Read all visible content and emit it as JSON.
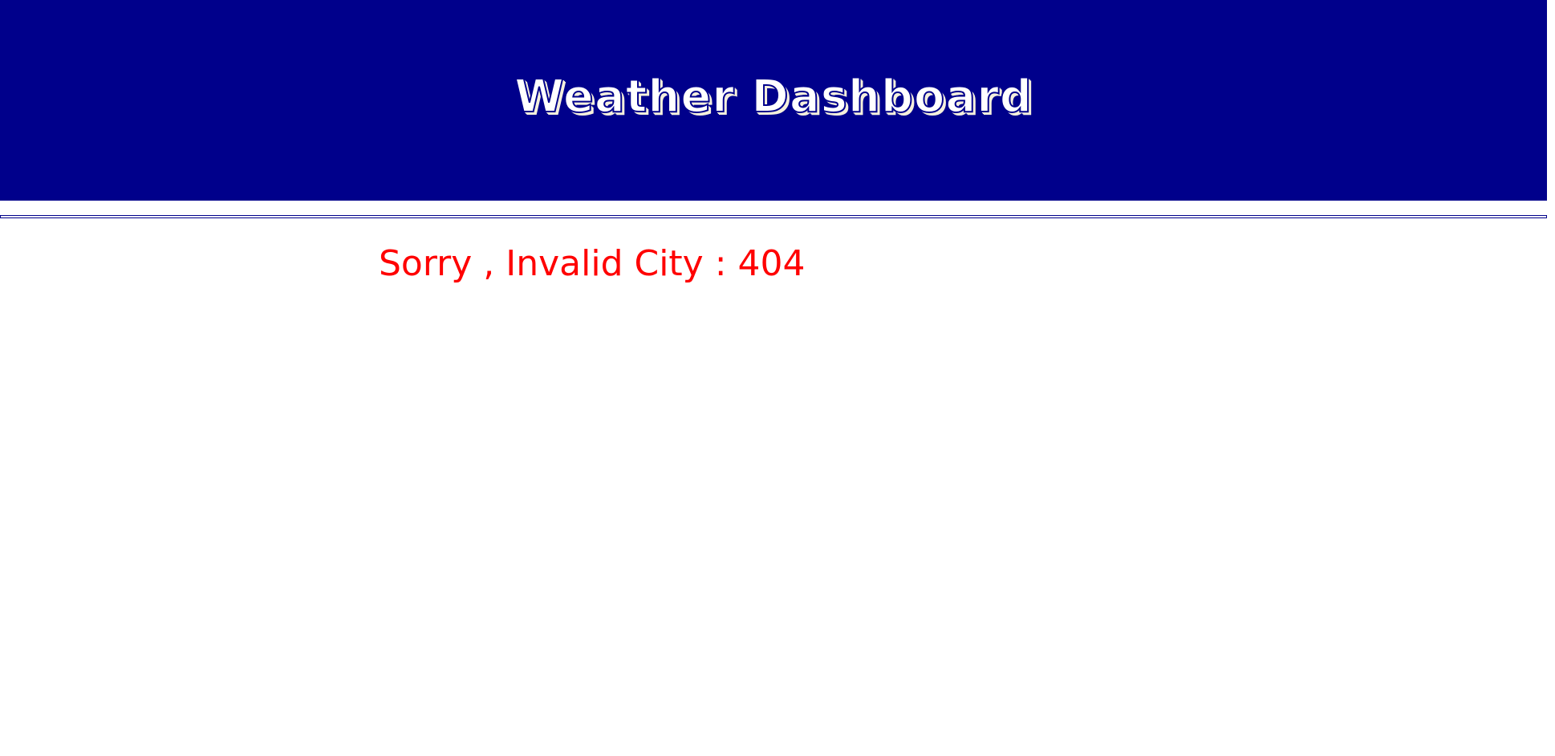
{
  "header": {
    "title": "Weather Dashboard"
  },
  "error": {
    "message": "Sorry , Invalid City : 404"
  },
  "colors": {
    "header_bg": "#00008b",
    "title_fill": "#ffffff",
    "title_shadow": "#f5f0dc",
    "error_text": "#ff0000",
    "page_bg": "#ffffff"
  }
}
